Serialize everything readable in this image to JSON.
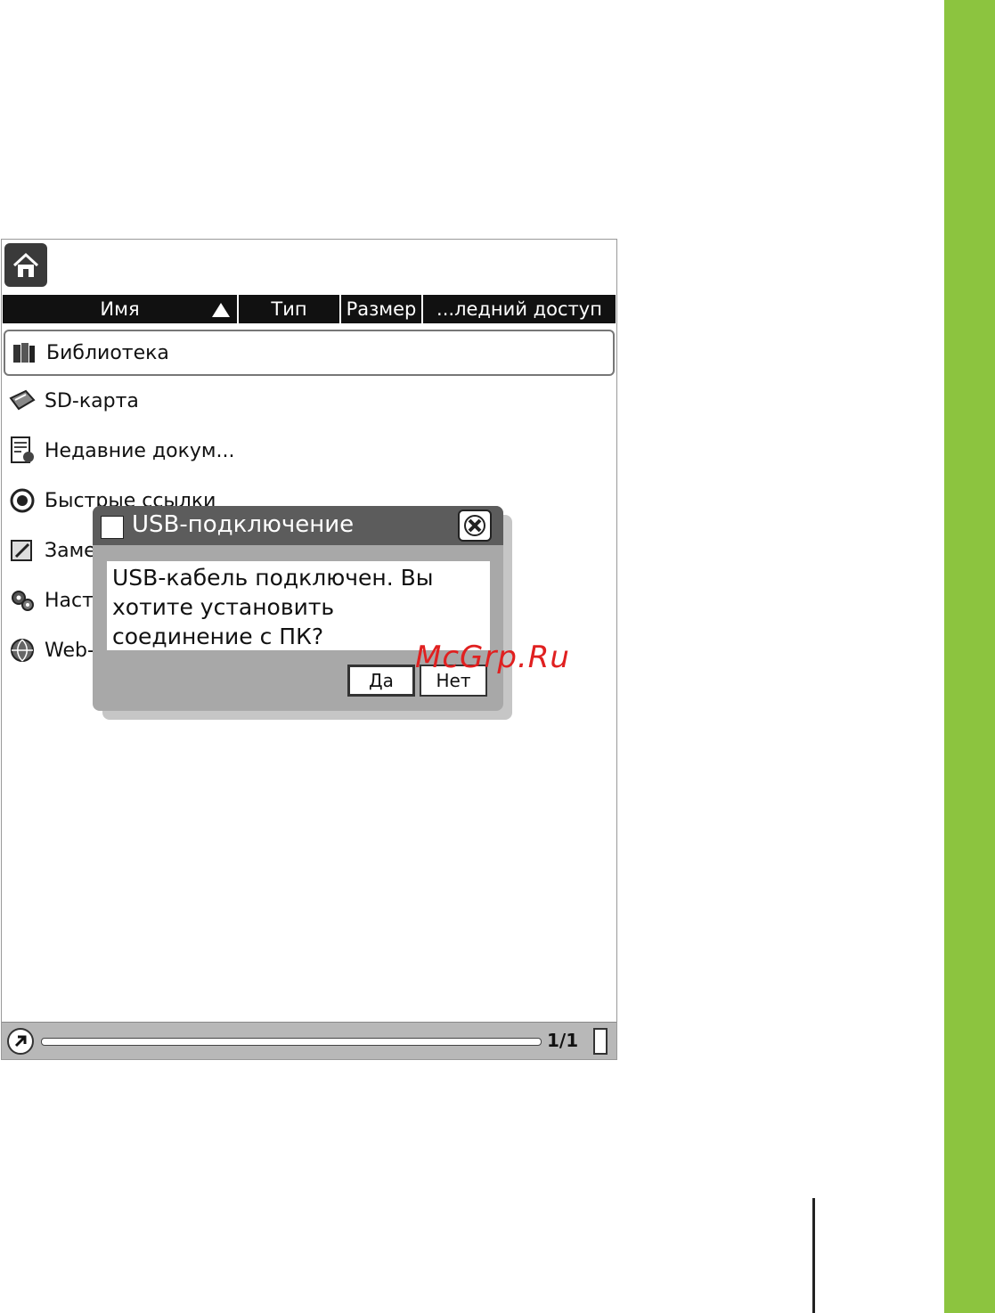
{
  "columns": {
    "name": "Имя",
    "type": "Тип",
    "size": "Размер",
    "last_access": "...ледний доступ"
  },
  "items": [
    {
      "label": "Библиотека",
      "icon": "library-icon"
    },
    {
      "label": "SD-карта",
      "icon": "sd-card-icon"
    },
    {
      "label": "Недавние докум...",
      "icon": "recent-docs-icon"
    },
    {
      "label": "Быстрые ссылки",
      "icon": "quick-links-icon"
    },
    {
      "label": "Заме",
      "icon": "notes-icon"
    },
    {
      "label": "Наст",
      "icon": "settings-icon"
    },
    {
      "label": "Web-",
      "icon": "web-icon"
    }
  ],
  "dialog": {
    "title": "USB-подключение",
    "message_lines": [
      "USB-кабель подключен. Вы",
      "хотите установить",
      "соединение с ПК?"
    ],
    "yes_label": "Да",
    "no_label": "Нет"
  },
  "status": {
    "page": "1/1"
  },
  "watermark": "McGrp.Ru",
  "colors": {
    "side_bar": "#8cc43f",
    "header_bg": "#111111",
    "watermark": "#e02020"
  }
}
